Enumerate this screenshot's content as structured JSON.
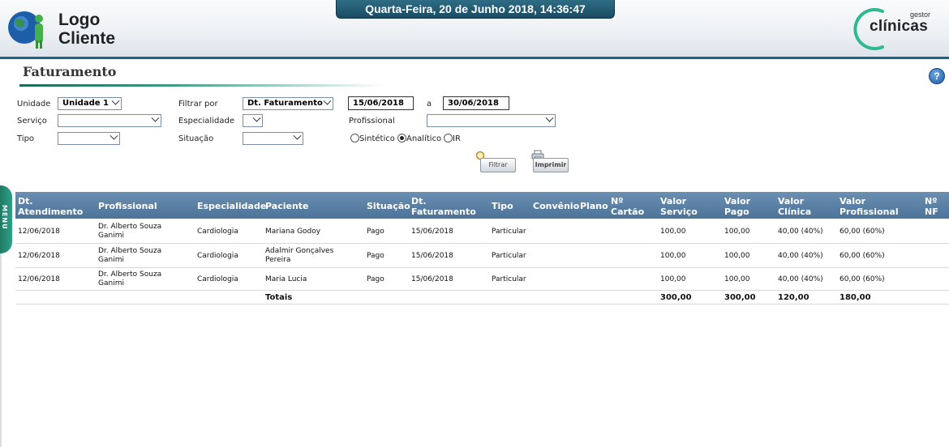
{
  "header": {
    "logo_line1": "Logo",
    "logo_line2": "Cliente",
    "datetime": "Quarta-Feira, 20 de Junho 2018, 14:36:47",
    "brand_small": "gestor",
    "brand_big": "clínicas",
    "accent_color": "#1f5b75",
    "brand_color": "#2fb98f"
  },
  "page": {
    "title": "Faturamento",
    "help_glyph": "?"
  },
  "filters": {
    "unidade_label": "Unidade",
    "unidade_value": "Unidade 1",
    "filtrar_por_label": "Filtrar por",
    "filtrar_por_value": "Dt. Faturamento",
    "date_from": "15/06/2018",
    "date_sep": "a",
    "date_to": "30/06/2018",
    "servico_label": "Serviço",
    "servico_value": "",
    "especialidade_label": "Especialidade",
    "especialidade_value": "",
    "profissional_label": "Profissional",
    "profissional_value": "",
    "tipo_label": "Tipo",
    "tipo_value": "",
    "situacao_label": "Situação",
    "situacao_value": "",
    "report_options": [
      "Sintético",
      "Analítico",
      "IR"
    ],
    "report_selected": "Analítico",
    "filter_button": "Filtrar",
    "print_button": "Imprimir"
  },
  "menu_tab": "MENU",
  "table": {
    "columns": [
      [
        "Dt.",
        "Atendimento"
      ],
      [
        "Profissional",
        ""
      ],
      [
        "Especialidade",
        ""
      ],
      [
        "Paciente",
        ""
      ],
      [
        "Situação",
        ""
      ],
      [
        "Dt.",
        "Faturamento"
      ],
      [
        "Tipo",
        ""
      ],
      [
        "Convênio",
        ""
      ],
      [
        "Plano",
        ""
      ],
      [
        "Nº",
        "Cartão"
      ],
      [
        "Valor",
        "Serviço"
      ],
      [
        "Valor",
        "Pago"
      ],
      [
        "Valor",
        "Clínica"
      ],
      [
        "Valor",
        "Profissional"
      ],
      [
        "Nº",
        "NF"
      ]
    ],
    "rows": [
      {
        "dt_atendimento": "12/06/2018",
        "profissional": [
          "Dr. Alberto Souza",
          "Ganimi"
        ],
        "especialidade": "Cardiologia",
        "paciente": [
          "Mariana Godoy",
          ""
        ],
        "situacao": "Pago",
        "dt_faturamento": "15/06/2018",
        "tipo": "Particular",
        "convenio": "",
        "plano": "",
        "cartao": "",
        "valor_servico": "100,00",
        "valor_pago": "100,00",
        "valor_clinica": "40,00 (40%)",
        "valor_profissional": "60,00 (60%)",
        "nf": ""
      },
      {
        "dt_atendimento": "12/06/2018",
        "profissional": [
          "Dr. Alberto Souza",
          "Ganimi"
        ],
        "especialidade": "Cardiologia",
        "paciente": [
          "Adalmir Gonçalves",
          "Pereira"
        ],
        "situacao": "Pago",
        "dt_faturamento": "15/06/2018",
        "tipo": "Particular",
        "convenio": "",
        "plano": "",
        "cartao": "",
        "valor_servico": "100,00",
        "valor_pago": "100,00",
        "valor_clinica": "40,00 (40%)",
        "valor_profissional": "60,00 (60%)",
        "nf": ""
      },
      {
        "dt_atendimento": "12/06/2018",
        "profissional": [
          "Dr. Alberto Souza",
          "Ganimi"
        ],
        "especialidade": "Cardiologia",
        "paciente": [
          "Maria Lucia",
          ""
        ],
        "situacao": "Pago",
        "dt_faturamento": "15/06/2018",
        "tipo": "Particular",
        "convenio": "",
        "plano": "",
        "cartao": "",
        "valor_servico": "100,00",
        "valor_pago": "100,00",
        "valor_clinica": "40,00 (40%)",
        "valor_profissional": "60,00 (60%)",
        "nf": ""
      }
    ],
    "totals": {
      "label": "Totais",
      "valor_servico": "300,00",
      "valor_pago": "300,00",
      "valor_clinica": "120,00",
      "valor_profissional": "180,00"
    }
  }
}
